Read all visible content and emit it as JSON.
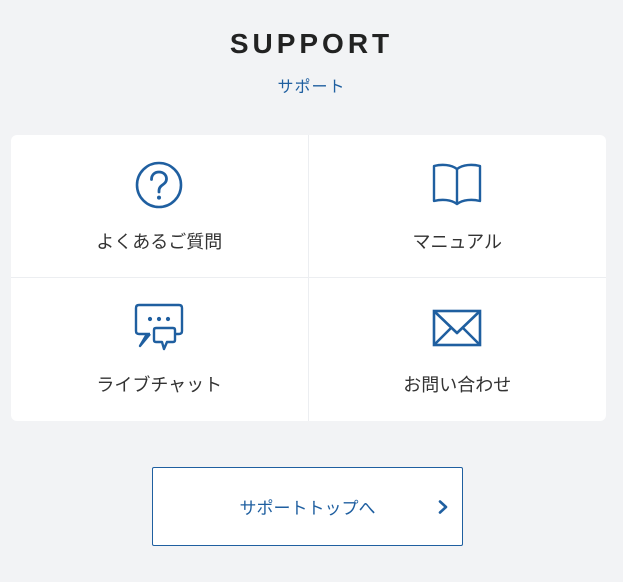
{
  "header": {
    "title": "SUPPORT",
    "subtitle": "サポート"
  },
  "tiles": [
    {
      "label": "よくあるご質問",
      "icon": "question-circle-icon"
    },
    {
      "label": "マニュアル",
      "icon": "open-book-icon"
    },
    {
      "label": "ライブチャット",
      "icon": "chat-bubbles-icon"
    },
    {
      "label": "お問い合わせ",
      "icon": "envelope-icon"
    }
  ],
  "cta": {
    "label": "サポートトップへ",
    "icon": "chevron-right-icon"
  },
  "colors": {
    "background": "#f2f3f5",
    "accent": "#1f5fa0",
    "text": "#333333",
    "card": "#ffffff"
  }
}
